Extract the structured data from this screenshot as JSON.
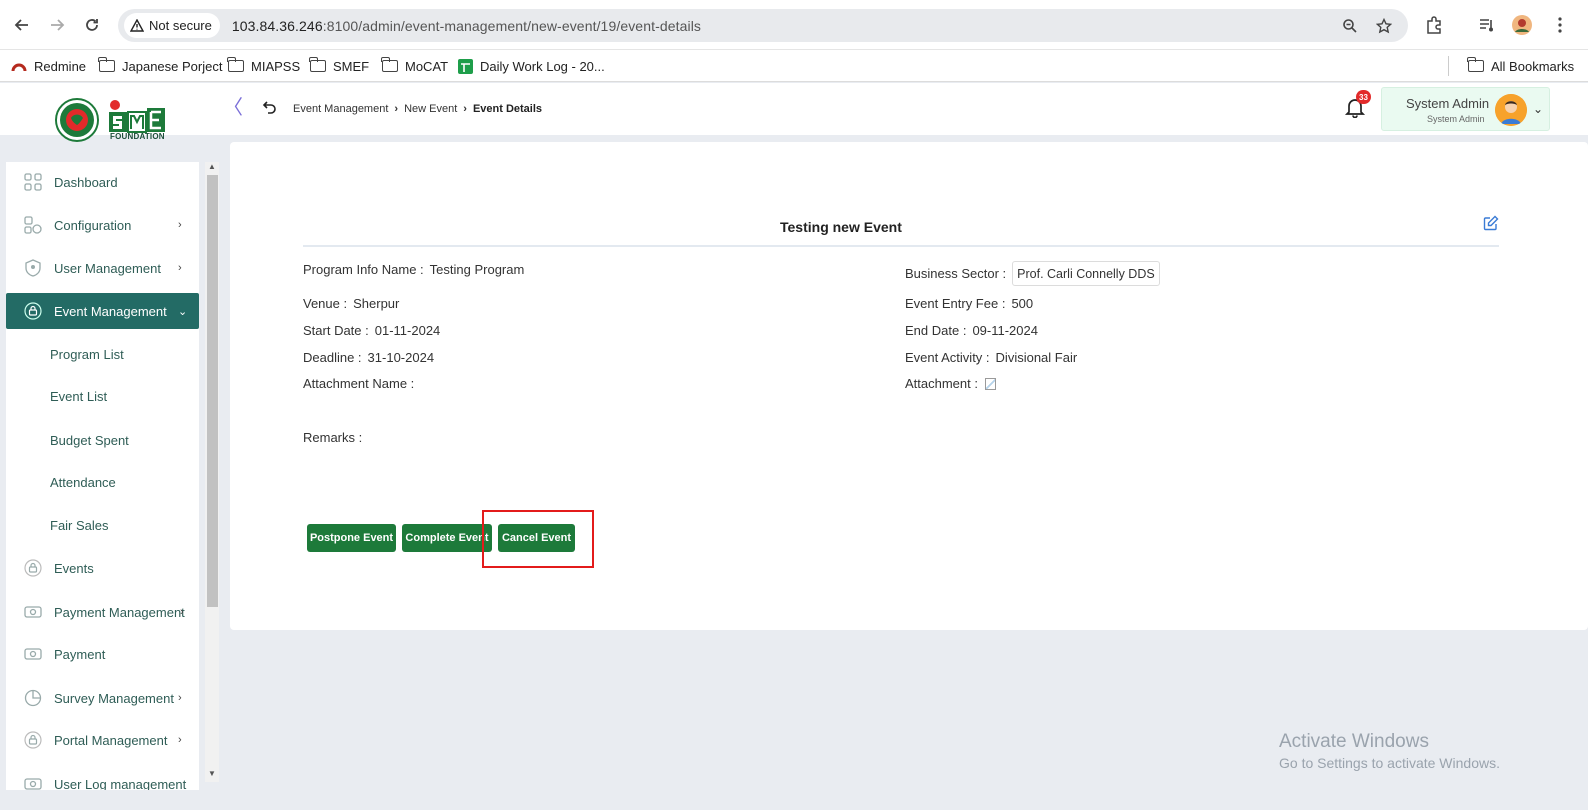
{
  "browser": {
    "security_label": "Not secure",
    "url_host": "103.84.36.246",
    "url_rest": ":8100/admin/event-management/new-event/19/event-details",
    "bookmarks": [
      {
        "label": "Redmine"
      },
      {
        "label": "Japanese Porject"
      },
      {
        "label": "MIAPSS"
      },
      {
        "label": "SMEF"
      },
      {
        "label": "MoCAT"
      },
      {
        "label": "Daily Work Log - 20..."
      }
    ],
    "all_bookmarks": "All Bookmarks"
  },
  "header": {
    "breadcrumb": [
      "Event Management",
      "New Event",
      "Event Details"
    ],
    "notification_count": "33",
    "user_name": "System Admin",
    "user_role": "System Admin"
  },
  "sidebar": {
    "items": [
      {
        "label": "Dashboard",
        "icon": "grid-icon"
      },
      {
        "label": "Configuration",
        "icon": "config-icon"
      },
      {
        "label": "User Management",
        "icon": "shield-icon"
      },
      {
        "label": "Event Management",
        "icon": "lock-icon",
        "active": true
      },
      {
        "label": "Events",
        "icon": "lock-icon"
      },
      {
        "label": "Payment Management",
        "icon": "money-icon"
      },
      {
        "label": "Payment",
        "icon": "money-icon"
      },
      {
        "label": "Survey Management",
        "icon": "pie-icon"
      },
      {
        "label": "Portal Management",
        "icon": "lock-icon"
      },
      {
        "label": "User Log management",
        "icon": "money-icon"
      }
    ],
    "sub_items": [
      "Program List",
      "Event List",
      "Budget Spent",
      "Attendance",
      "Fair Sales"
    ]
  },
  "event": {
    "title": "Testing new Event",
    "program_info_label": "Program Info Name :",
    "program_info_value": "Testing Program",
    "business_sector_label": "Business Sector :",
    "business_sector_value": "Prof. Carli Connelly DDS",
    "venue_label": "Venue :",
    "venue_value": "Sherpur",
    "entry_fee_label": "Event Entry Fee :",
    "entry_fee_value": "500",
    "start_date_label": "Start Date :",
    "start_date_value": "01-11-2024",
    "end_date_label": "End Date :",
    "end_date_value": "09-11-2024",
    "deadline_label": "Deadline :",
    "deadline_value": "31-10-2024",
    "activity_label": "Event Activity :",
    "activity_value": "Divisional Fair",
    "attachment_name_label": "Attachment Name :",
    "attachment_label": "Attachment :",
    "remarks_label": "Remarks :"
  },
  "actions": {
    "postpone": "Postpone Event",
    "complete": "Complete Event",
    "cancel": "Cancel Event"
  },
  "watermark": {
    "line1": "Activate Windows",
    "line2": "Go to Settings to activate Windows."
  },
  "colors": {
    "sidebar_active": "#236b65",
    "action_button": "#1d7a3a",
    "highlight": "#e31b1b",
    "badge": "#e22a2a"
  }
}
